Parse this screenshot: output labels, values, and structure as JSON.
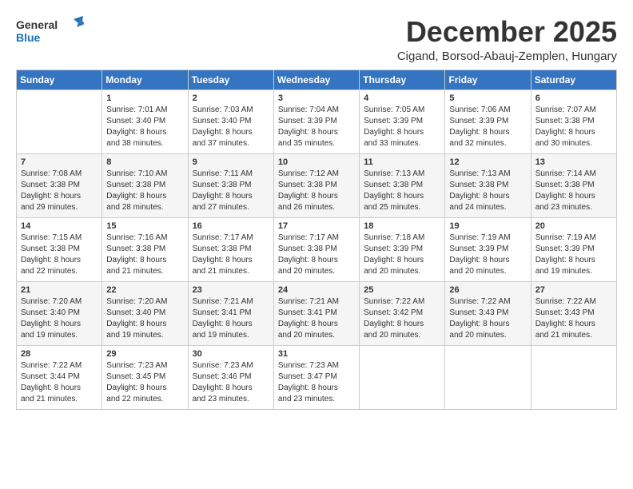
{
  "header": {
    "logo_general": "General",
    "logo_blue": "Blue",
    "title": "December 2025",
    "subtitle": "Cigand, Borsod-Abauj-Zemplen, Hungary"
  },
  "weekdays": [
    "Sunday",
    "Monday",
    "Tuesday",
    "Wednesday",
    "Thursday",
    "Friday",
    "Saturday"
  ],
  "weeks": [
    [
      {
        "day": "",
        "info": ""
      },
      {
        "day": "1",
        "info": "Sunrise: 7:01 AM\nSunset: 3:40 PM\nDaylight: 8 hours\nand 38 minutes."
      },
      {
        "day": "2",
        "info": "Sunrise: 7:03 AM\nSunset: 3:40 PM\nDaylight: 8 hours\nand 37 minutes."
      },
      {
        "day": "3",
        "info": "Sunrise: 7:04 AM\nSunset: 3:39 PM\nDaylight: 8 hours\nand 35 minutes."
      },
      {
        "day": "4",
        "info": "Sunrise: 7:05 AM\nSunset: 3:39 PM\nDaylight: 8 hours\nand 33 minutes."
      },
      {
        "day": "5",
        "info": "Sunrise: 7:06 AM\nSunset: 3:39 PM\nDaylight: 8 hours\nand 32 minutes."
      },
      {
        "day": "6",
        "info": "Sunrise: 7:07 AM\nSunset: 3:38 PM\nDaylight: 8 hours\nand 30 minutes."
      }
    ],
    [
      {
        "day": "7",
        "info": "Sunrise: 7:08 AM\nSunset: 3:38 PM\nDaylight: 8 hours\nand 29 minutes."
      },
      {
        "day": "8",
        "info": "Sunrise: 7:10 AM\nSunset: 3:38 PM\nDaylight: 8 hours\nand 28 minutes."
      },
      {
        "day": "9",
        "info": "Sunrise: 7:11 AM\nSunset: 3:38 PM\nDaylight: 8 hours\nand 27 minutes."
      },
      {
        "day": "10",
        "info": "Sunrise: 7:12 AM\nSunset: 3:38 PM\nDaylight: 8 hours\nand 26 minutes."
      },
      {
        "day": "11",
        "info": "Sunrise: 7:13 AM\nSunset: 3:38 PM\nDaylight: 8 hours\nand 25 minutes."
      },
      {
        "day": "12",
        "info": "Sunrise: 7:13 AM\nSunset: 3:38 PM\nDaylight: 8 hours\nand 24 minutes."
      },
      {
        "day": "13",
        "info": "Sunrise: 7:14 AM\nSunset: 3:38 PM\nDaylight: 8 hours\nand 23 minutes."
      }
    ],
    [
      {
        "day": "14",
        "info": "Sunrise: 7:15 AM\nSunset: 3:38 PM\nDaylight: 8 hours\nand 22 minutes."
      },
      {
        "day": "15",
        "info": "Sunrise: 7:16 AM\nSunset: 3:38 PM\nDaylight: 8 hours\nand 21 minutes."
      },
      {
        "day": "16",
        "info": "Sunrise: 7:17 AM\nSunset: 3:38 PM\nDaylight: 8 hours\nand 21 minutes."
      },
      {
        "day": "17",
        "info": "Sunrise: 7:17 AM\nSunset: 3:38 PM\nDaylight: 8 hours\nand 20 minutes."
      },
      {
        "day": "18",
        "info": "Sunrise: 7:18 AM\nSunset: 3:39 PM\nDaylight: 8 hours\nand 20 minutes."
      },
      {
        "day": "19",
        "info": "Sunrise: 7:19 AM\nSunset: 3:39 PM\nDaylight: 8 hours\nand 20 minutes."
      },
      {
        "day": "20",
        "info": "Sunrise: 7:19 AM\nSunset: 3:39 PM\nDaylight: 8 hours\nand 19 minutes."
      }
    ],
    [
      {
        "day": "21",
        "info": "Sunrise: 7:20 AM\nSunset: 3:40 PM\nDaylight: 8 hours\nand 19 minutes."
      },
      {
        "day": "22",
        "info": "Sunrise: 7:20 AM\nSunset: 3:40 PM\nDaylight: 8 hours\nand 19 minutes."
      },
      {
        "day": "23",
        "info": "Sunrise: 7:21 AM\nSunset: 3:41 PM\nDaylight: 8 hours\nand 19 minutes."
      },
      {
        "day": "24",
        "info": "Sunrise: 7:21 AM\nSunset: 3:41 PM\nDaylight: 8 hours\nand 20 minutes."
      },
      {
        "day": "25",
        "info": "Sunrise: 7:22 AM\nSunset: 3:42 PM\nDaylight: 8 hours\nand 20 minutes."
      },
      {
        "day": "26",
        "info": "Sunrise: 7:22 AM\nSunset: 3:43 PM\nDaylight: 8 hours\nand 20 minutes."
      },
      {
        "day": "27",
        "info": "Sunrise: 7:22 AM\nSunset: 3:43 PM\nDaylight: 8 hours\nand 21 minutes."
      }
    ],
    [
      {
        "day": "28",
        "info": "Sunrise: 7:22 AM\nSunset: 3:44 PM\nDaylight: 8 hours\nand 21 minutes."
      },
      {
        "day": "29",
        "info": "Sunrise: 7:23 AM\nSunset: 3:45 PM\nDaylight: 8 hours\nand 22 minutes."
      },
      {
        "day": "30",
        "info": "Sunrise: 7:23 AM\nSunset: 3:46 PM\nDaylight: 8 hours\nand 23 minutes."
      },
      {
        "day": "31",
        "info": "Sunrise: 7:23 AM\nSunset: 3:47 PM\nDaylight: 8 hours\nand 23 minutes."
      },
      {
        "day": "",
        "info": ""
      },
      {
        "day": "",
        "info": ""
      },
      {
        "day": "",
        "info": ""
      }
    ]
  ]
}
